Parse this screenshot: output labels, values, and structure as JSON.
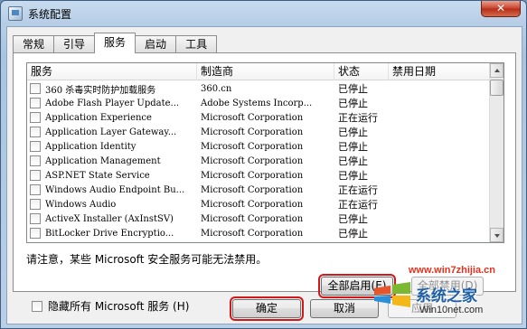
{
  "window": {
    "title": "系统配置",
    "close_label": "✕"
  },
  "tabs": [
    {
      "label": "常规",
      "active": false
    },
    {
      "label": "引导",
      "active": false
    },
    {
      "label": "服务",
      "active": true
    },
    {
      "label": "启动",
      "active": false
    },
    {
      "label": "工具",
      "active": false
    }
  ],
  "list": {
    "headers": {
      "service": "服务",
      "manufacturer": "制造商",
      "status": "状态",
      "disabled_date": "禁用日期"
    },
    "rows": [
      {
        "service": "360 杀毒实时防护加载服务",
        "manufacturer": "360.cn",
        "status": "已停止",
        "checked": false
      },
      {
        "service": "Adobe Flash Player Update...",
        "manufacturer": "Adobe Systems Incorp...",
        "status": "已停止",
        "checked": false
      },
      {
        "service": "Application Experience",
        "manufacturer": "Microsoft Corporation",
        "status": "正在运行",
        "checked": false
      },
      {
        "service": "Application Layer Gateway...",
        "manufacturer": "Microsoft Corporation",
        "status": "已停止",
        "checked": false
      },
      {
        "service": "Application Identity",
        "manufacturer": "Microsoft Corporation",
        "status": "已停止",
        "checked": false
      },
      {
        "service": "Application Management",
        "manufacturer": "Microsoft Corporation",
        "status": "已停止",
        "checked": false
      },
      {
        "service": "ASP.NET State Service",
        "manufacturer": "Microsoft Corporation",
        "status": "已停止",
        "checked": false
      },
      {
        "service": "Windows Audio Endpoint Bu...",
        "manufacturer": "Microsoft Corporation",
        "status": "正在运行",
        "checked": false
      },
      {
        "service": "Windows Audio",
        "manufacturer": "Microsoft Corporation",
        "status": "正在运行",
        "checked": false
      },
      {
        "service": "ActiveX Installer (AxInstSV)",
        "manufacturer": "Microsoft Corporation",
        "status": "已停止",
        "checked": false
      },
      {
        "service": "BitLocker Drive Encryptio...",
        "manufacturer": "Microsoft Corporation",
        "status": "已停止",
        "checked": false
      }
    ]
  },
  "note": "请注意，某些 Microsoft 安全服务可能无法禁用。",
  "buttons": {
    "enable_all": "全部启用(E)",
    "disable_all": "全部禁用(D)",
    "ok": "确定",
    "cancel": "取消",
    "apply": "应用"
  },
  "hide_ms": {
    "label": "隐藏所有 Microsoft 服务 (H)",
    "checked": false
  },
  "watermark": {
    "url": "www.win7zhijia.cn",
    "name": "系统之家",
    "site": "Win10net.com"
  },
  "colors": {
    "highlight": "#d01818",
    "title_bar": "#b6cde6",
    "close_button": "#c7412c"
  },
  "icons": [
    "window-app-icon",
    "close-icon",
    "scroll-up-icon",
    "scroll-down-icon",
    "windows-logo-icon"
  ]
}
